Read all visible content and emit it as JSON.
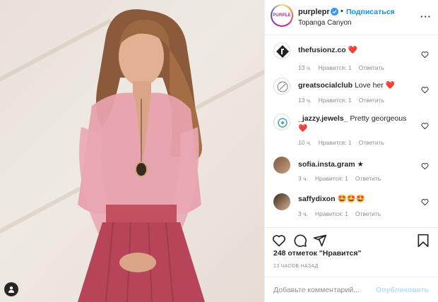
{
  "post": {
    "username": "purplepr",
    "avatar_text": "PURPLE",
    "follow_label": "Подписаться",
    "separator": "•",
    "location": "Topanga Canyon",
    "more_label": "···"
  },
  "comments": [
    {
      "username": "thefusionz.co",
      "text": "",
      "emoji": "❤️",
      "time": "13 ч.",
      "likes": "Нравится: 1",
      "reply": "Ответить"
    },
    {
      "username": "greatsocialclub",
      "text": "Love her",
      "emoji": "❤️",
      "time": "13 ч.",
      "likes": "Нравится: 1",
      "reply": "Ответить"
    },
    {
      "username": "_jazzy.jewels_",
      "text": "Pretty georgeous",
      "emoji": "❤️",
      "time": "10 ч.",
      "likes": "Нравится: 1",
      "reply": "Ответить"
    },
    {
      "username": "sofia.insta.gram",
      "text": "★",
      "emoji": "",
      "time": "3 ч.",
      "likes": "Нравится: 1",
      "reply": "Ответить"
    },
    {
      "username": "saffydixon",
      "text": "",
      "emoji": "🤩🤩🤩",
      "time": "3 ч.",
      "likes": "Нравится: 1",
      "reply": "Ответить"
    }
  ],
  "footer": {
    "likes_text": "248 отметок \"Нравится\"",
    "time_text": "13 ЧАСОВ НАЗАД",
    "add_placeholder": "Добавьте комментарий...",
    "publish_label": "Опубликовать"
  },
  "colors": {
    "accent": "#0095f6",
    "heart": "#ed4956",
    "publish_disabled": "#b2dffc",
    "muted": "#8e8e8e"
  },
  "icons": [
    "heart-icon",
    "comment-icon",
    "share-icon",
    "bookmark-icon",
    "verified-icon",
    "tag-icon",
    "more-icon"
  ]
}
